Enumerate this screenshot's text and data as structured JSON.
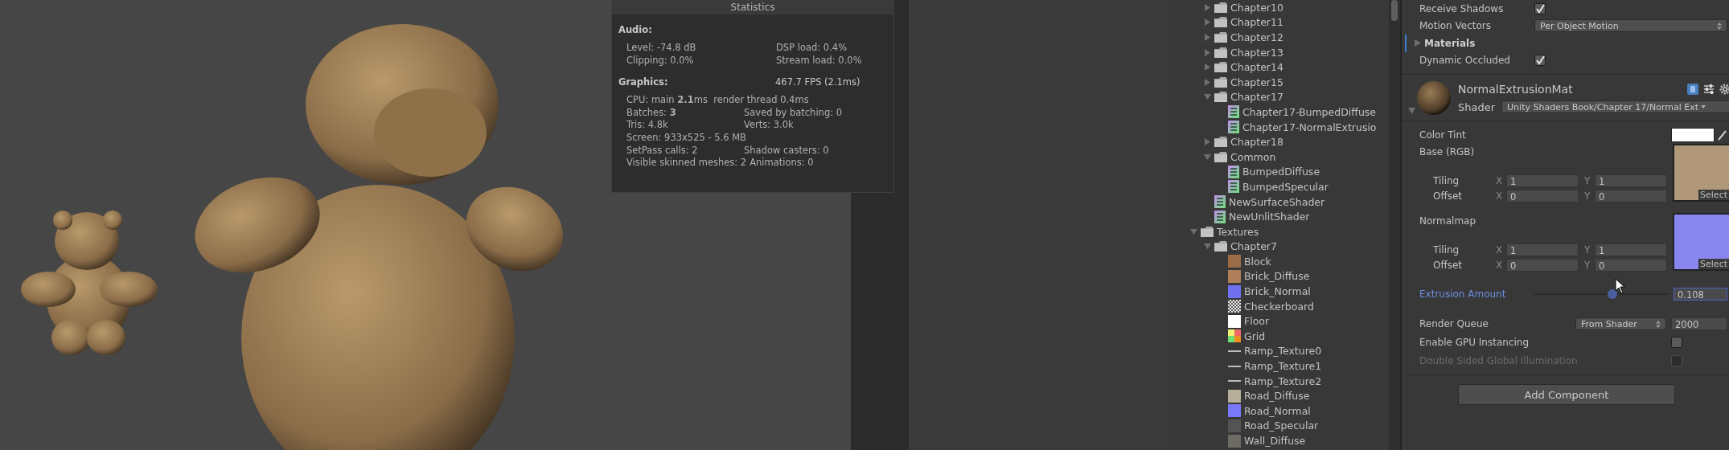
{
  "scene_view": {
    "statistics": {
      "title": "Statistics",
      "sections": [
        {
          "heading": "Audio:",
          "lines": [
            [
              "Level: -74.8 dB",
              "DSP load: 0.4%"
            ],
            [
              "Clipping: 0.0%",
              "Stream load: 0.0%"
            ]
          ]
        },
        {
          "heading": "Graphics:",
          "summary": "467.7 FPS (2.1ms)",
          "lines": [
            [
              "CPU: main **2.1**ms  render thread 0.4ms"
            ],
            [
              "Batches: **3**",
              "Saved by batching: 0"
            ],
            [
              "Tris: 4.8k",
              "Verts: 3.0k"
            ],
            [
              "Screen: 933x525 - 5.6 MB"
            ],
            [
              "SetPass calls: 2",
              "Shadow casters: 0"
            ],
            [
              "Visible skinned meshes: 2",
              "Animations: 0"
            ]
          ]
        }
      ]
    }
  },
  "project_tree": {
    "cut_folder_children": [
      {
        "name": "Chapter10",
        "kind": "folder",
        "expanded": false
      },
      {
        "name": "Chapter11",
        "kind": "folder",
        "expanded": false
      },
      {
        "name": "Chapter12",
        "kind": "folder",
        "expanded": false
      },
      {
        "name": "Chapter13",
        "kind": "folder",
        "expanded": false
      },
      {
        "name": "Chapter14",
        "kind": "folder",
        "expanded": false
      },
      {
        "name": "Chapter15",
        "kind": "folder",
        "expanded": false
      },
      {
        "name": "Chapter17",
        "kind": "folder",
        "expanded": true,
        "children": [
          {
            "name": "Chapter17-BumpedDiffuse",
            "kind": "shader"
          },
          {
            "name": "Chapter17-NormalExtrusio",
            "kind": "shader"
          }
        ]
      },
      {
        "name": "Chapter18",
        "kind": "folder",
        "expanded": false
      },
      {
        "name": "Common",
        "kind": "folder",
        "expanded": true,
        "children": [
          {
            "name": "BumpedDiffuse",
            "kind": "shader"
          },
          {
            "name": "BumpedSpecular",
            "kind": "shader"
          }
        ]
      },
      {
        "name": "NewSurfaceShader",
        "kind": "shader"
      },
      {
        "name": "NewUnlitShader",
        "kind": "shader"
      }
    ],
    "folders": [
      {
        "name": "Textures",
        "kind": "folder",
        "expanded": true,
        "children": [
          {
            "name": "Chapter7",
            "kind": "folder",
            "expanded": true,
            "children": [
              {
                "name": "Block",
                "kind": "texture",
                "color": "#9a6c48"
              },
              {
                "name": "Brick_Diffuse",
                "kind": "texture",
                "color": "#b0805c"
              },
              {
                "name": "Brick_Normal",
                "kind": "texture",
                "color": "#7070f0"
              },
              {
                "name": "Checkerboard",
                "kind": "checker"
              },
              {
                "name": "Floor",
                "kind": "texture",
                "color": "#ffffff"
              },
              {
                "name": "Grid",
                "kind": "grid"
              },
              {
                "name": "Ramp_Texture0",
                "kind": "ramp"
              },
              {
                "name": "Ramp_Texture1",
                "kind": "ramp"
              },
              {
                "name": "Ramp_Texture2",
                "kind": "ramp"
              },
              {
                "name": "Road_Diffuse",
                "kind": "texture",
                "color": "#b8ae9c"
              },
              {
                "name": "Road_Normal",
                "kind": "texture",
                "color": "#7878f8"
              },
              {
                "name": "Road_Specular",
                "kind": "texture",
                "color": "#545454"
              },
              {
                "name": "Wall_Diffuse",
                "kind": "texture",
                "color": "#6e6a64"
              }
            ]
          }
        ]
      }
    ]
  },
  "inspector": {
    "receive_shadows": {
      "label": "Receive Shadows",
      "checked": true
    },
    "motion_vectors": {
      "label": "Motion Vectors",
      "value": "Per Object Motion"
    },
    "materials": {
      "label": "Materials",
      "expanded": false
    },
    "dynamic_occluded": {
      "label": "Dynamic Occluded",
      "checked": true
    },
    "material": {
      "name": "NormalExtrusionMat",
      "expanded": true,
      "shader_label": "Shader",
      "shader": "Unity Shaders Book/Chapter 17/Normal Ext",
      "properties": [
        {
          "kind": "color",
          "label": "Color Tint",
          "color": "#ffffff"
        },
        {
          "kind": "texture",
          "label": "Base (RGB)",
          "color": "#b09878",
          "select": "Select",
          "tiling_label": "Tiling",
          "offset_label": "Offset",
          "tiling": [
            {
              "axis": "X",
              "value": "1"
            },
            {
              "axis": "Y",
              "value": "1"
            }
          ],
          "offset": [
            {
              "axis": "X",
              "value": "0"
            },
            {
              "axis": "Y",
              "value": "0"
            }
          ]
        },
        {
          "kind": "texture",
          "label": "Normalmap",
          "color": "#8a86f0",
          "select": "Select",
          "tiling_label": "Tiling",
          "offset_label": "Offset",
          "tiling": [
            {
              "axis": "X",
              "value": "1"
            },
            {
              "axis": "Y",
              "value": "1"
            }
          ],
          "offset": [
            {
              "axis": "X",
              "value": "0"
            },
            {
              "axis": "Y",
              "value": "0"
            }
          ]
        },
        {
          "kind": "slider",
          "label": "Extrusion Amount",
          "focused": true,
          "level": 0.59,
          "value": "0.108"
        }
      ],
      "render_queue": {
        "label": "Render Queue",
        "mode": "From Shader",
        "value": "2000"
      },
      "toggles": [
        {
          "label": "Enable GPU Instancing",
          "checked": false,
          "disabled": false
        },
        {
          "label": "Double Sided Global Illumination",
          "checked": false,
          "disabled": true
        }
      ]
    },
    "add_component": "Add Component"
  }
}
